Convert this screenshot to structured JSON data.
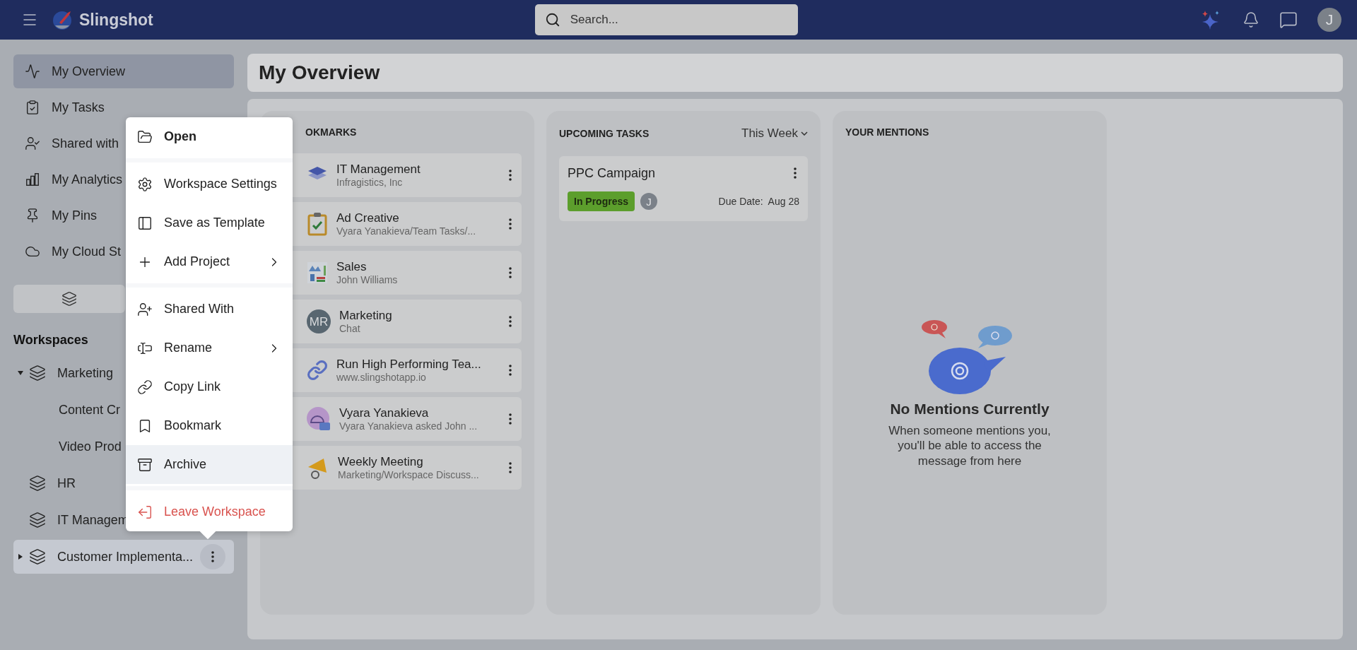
{
  "header": {
    "app_name": "Slingshot",
    "search": {
      "placeholder": "Search..."
    },
    "avatar": "J"
  },
  "sidebar": {
    "nav": [
      {
        "label": "My Overview",
        "selected": true
      },
      {
        "label": "My Tasks",
        "selected": false
      },
      {
        "label": "Shared with",
        "selected": false
      },
      {
        "label": "My Analytics",
        "selected": false
      },
      {
        "label": "My Pins",
        "selected": false
      },
      {
        "label": "My Cloud St",
        "selected": false
      }
    ],
    "workspaces": {
      "title": "Workspaces",
      "items": [
        {
          "label": "Marketing",
          "kind": "folder",
          "expanded": true,
          "selected": false,
          "children": [
            {
              "label": "Content Cr",
              "selected": false
            },
            {
              "label": "Video Prod",
              "selected": false
            }
          ]
        },
        {
          "label": "HR",
          "kind": "plain",
          "selected": false
        },
        {
          "label": "IT Managem",
          "kind": "plain",
          "selected": false
        },
        {
          "label": "Customer Implementa...",
          "kind": "folder",
          "expanded": false,
          "selected": true
        }
      ]
    }
  },
  "context_menu": {
    "groups": [
      [
        {
          "label": "Open",
          "kind": "primary",
          "submenu": false,
          "hovered": false
        }
      ],
      [
        {
          "label": "Workspace Settings",
          "kind": "normal",
          "submenu": false,
          "hovered": false
        },
        {
          "label": "Save as Template",
          "kind": "normal",
          "submenu": false,
          "hovered": false
        },
        {
          "label": "Add Project",
          "kind": "normal",
          "submenu": true,
          "hovered": false
        }
      ],
      [
        {
          "label": "Shared With",
          "kind": "normal",
          "submenu": false,
          "hovered": false
        },
        {
          "label": "Rename",
          "kind": "normal",
          "submenu": true,
          "hovered": false
        },
        {
          "label": "Copy Link",
          "kind": "normal",
          "submenu": false,
          "hovered": false
        },
        {
          "label": "Bookmark",
          "kind": "normal",
          "submenu": false,
          "hovered": false
        },
        {
          "label": "Archive",
          "kind": "normal",
          "submenu": false,
          "hovered": true
        }
      ],
      [
        {
          "label": "Leave Workspace",
          "kind": "danger",
          "submenu": false,
          "hovered": false
        }
      ]
    ]
  },
  "main": {
    "title": "My Overview",
    "bookmarks": {
      "title": "OKMARKS",
      "items": [
        {
          "title": "IT Management",
          "subtitle": "Infragistics, Inc",
          "kind": "layers"
        },
        {
          "title": "Ad Creative",
          "subtitle": "Vyara Yanakieva/Team Tasks/...",
          "kind": "clipboard"
        },
        {
          "title": "Sales",
          "subtitle": "John Williams",
          "kind": "chart"
        },
        {
          "title": "Marketing",
          "subtitle": "Chat",
          "kind": "initials",
          "initials": "MR"
        },
        {
          "title": "Run High Performing Tea...",
          "subtitle": "www.slingshotapp.io",
          "kind": "link"
        },
        {
          "title": "Vyara Yanakieva",
          "subtitle": "Vyara Yanakieva asked John ...",
          "kind": "planner"
        },
        {
          "title": "Weekly Meeting",
          "subtitle": "Marketing/Workspace Discuss...",
          "kind": "megaphone"
        }
      ]
    },
    "upcoming_tasks": {
      "title": "UPCOMING TASKS",
      "filter": "This Week",
      "tasks": [
        {
          "title": "PPC Campaign",
          "status": {
            "label": "In Progress",
            "color": "#5c9e2c"
          },
          "assignee": "J",
          "due_label": "Due Date:",
          "due": "Aug 28"
        }
      ]
    },
    "mentions": {
      "title": "YOUR MENTIONS",
      "empty_title": "No Mentions Currently",
      "empty_text": "When someone mentions you, you'll be able to access the message from here"
    }
  }
}
